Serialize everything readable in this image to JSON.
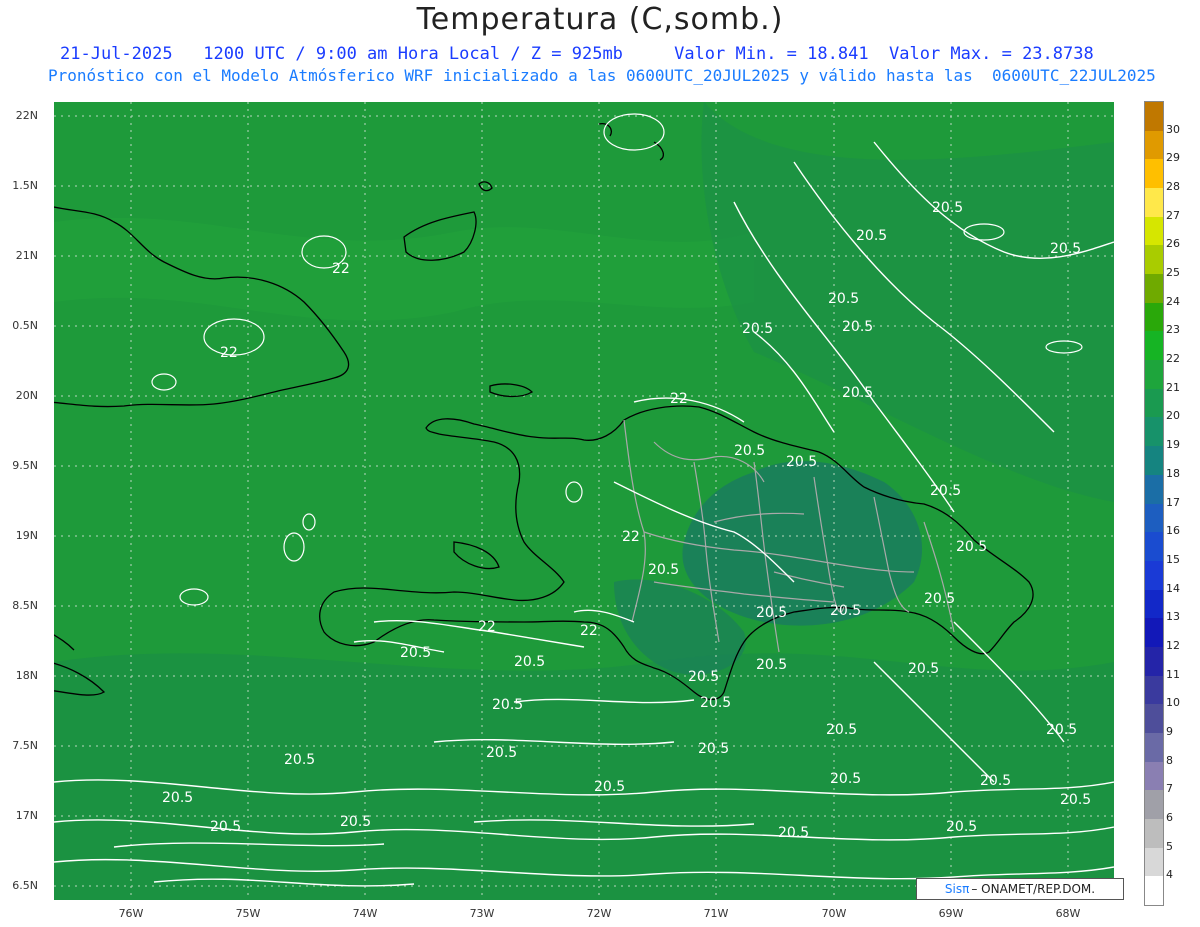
{
  "header": {
    "title": "Temperatura (C,somb.)",
    "line2": "21-Jul-2025   1200 UTC / 9:00 am Hora Local / Z = 925mb     Valor Min. = 18.841  Valor Max. = 23.8738",
    "line3": "Pronóstico con el Modelo Atmósferico WRF inicializado a las 0600UTC_20JUL2025 y válido hasta las  0600UTC_22JUL2025"
  },
  "axes": {
    "lat_labels": [
      "22N",
      "1.5N",
      "21N",
      "0.5N",
      "20N",
      "9.5N",
      "19N",
      "8.5N",
      "18N",
      "7.5N",
      "17N",
      "6.5N"
    ],
    "lon_labels": [
      "76W",
      "75W",
      "74W",
      "73W",
      "72W",
      "71W",
      "70W",
      "69W",
      "68W"
    ]
  },
  "contour_labels": [
    "22",
    "22",
    "22",
    "22",
    "22",
    "22",
    "20.5",
    "20.5",
    "20.5",
    "20.5",
    "20.5",
    "20.5",
    "20.5",
    "20.5",
    "20.5",
    "20.5",
    "20.5",
    "20.5",
    "20.5",
    "20.5",
    "20.5",
    "20.5",
    "20.5",
    "20.5",
    "20.5",
    "20.5",
    "20.5",
    "20.5",
    "20.5",
    "20.5",
    "20.5",
    "20.5",
    "20.5",
    "20.5",
    "20.5",
    "20.5",
    "20.5",
    "20.5",
    "20.5",
    "20.5",
    "20.5",
    "20.5"
  ],
  "colorbar": {
    "labels": [
      "30",
      "29",
      "28",
      "27",
      "26",
      "25",
      "24",
      "23",
      "22",
      "21",
      "20",
      "19",
      "18",
      "17",
      "16",
      "15",
      "14",
      "13",
      "12",
      "11",
      "10",
      "9",
      "8",
      "7",
      "6",
      "5",
      "4"
    ],
    "colors": [
      "#c07800",
      "#e09a00",
      "#ffbf00",
      "#ffe84a",
      "#d6e600",
      "#a9cc00",
      "#6faa00",
      "#2aa80a",
      "#16b424",
      "#1ea53c",
      "#1a9a50",
      "#17926a",
      "#158480",
      "#1b6ea6",
      "#1d5ec0",
      "#1a4cd0",
      "#1a3ad6",
      "#1228c8",
      "#1218b8",
      "#2424a8",
      "#3a3a9e",
      "#4e4e9a",
      "#6a6aa6",
      "#8a7fb2",
      "#a0a0a8",
      "#bdbdbd",
      "#d8d8d8",
      "#ffffff"
    ]
  },
  "credit": {
    "sis": "Sisπ",
    "org": "– ONAMET/REP.DOM."
  }
}
